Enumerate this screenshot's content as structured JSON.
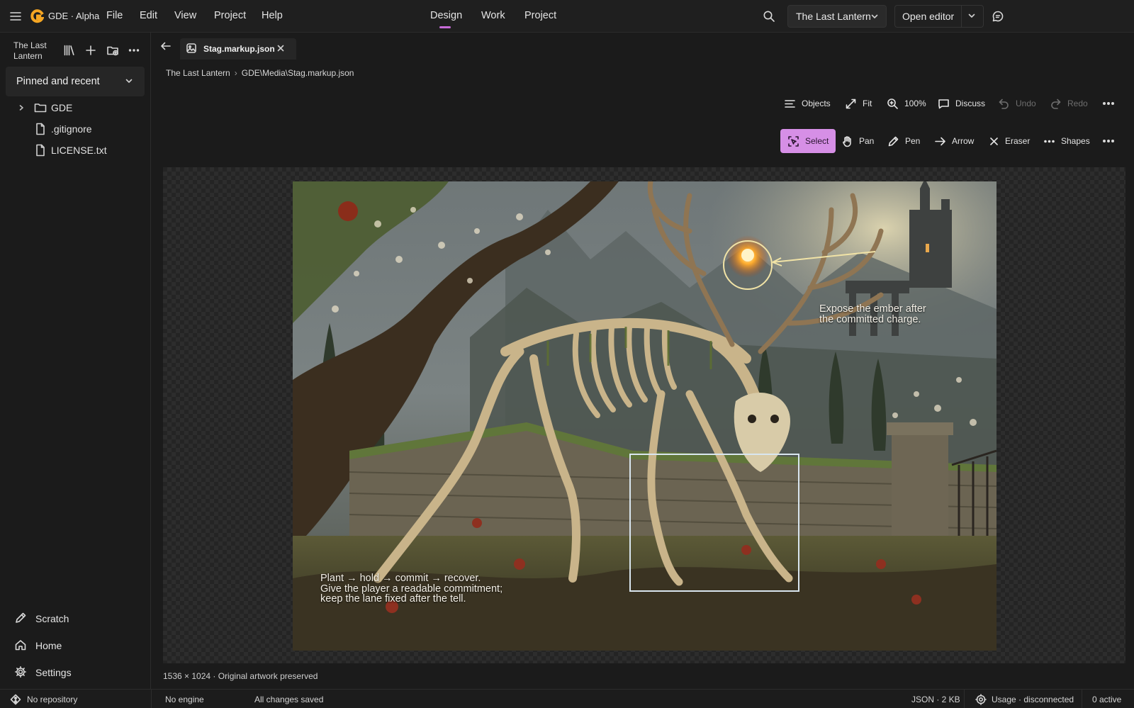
{
  "app": {
    "name": "GDE · Alpha",
    "logo_letter": "G",
    "logo_color": "#f5a623"
  },
  "menu": [
    "File",
    "Edit",
    "View",
    "Project",
    "Help"
  ],
  "center_tabs": {
    "design": "Design",
    "work": "Work",
    "project": "Project",
    "active": "Design",
    "accent": "#c86bd8"
  },
  "header": {
    "project_select": "The Last Lantern",
    "open_editor": "Open editor"
  },
  "sidebar": {
    "project_name": "The Last Lantern",
    "pinned_label": "Pinned and recent",
    "tree": [
      {
        "label": "GDE",
        "kind": "folder",
        "collapsed": true
      },
      {
        "label": ".gitignore",
        "kind": "file"
      },
      {
        "label": "LICENSE.txt",
        "kind": "file"
      }
    ],
    "nav": {
      "scratch": "Scratch",
      "home": "Home",
      "settings": "Settings"
    }
  },
  "editor": {
    "tab": {
      "label": "Stag.markup.json"
    },
    "breadcrumb": {
      "root": "The Last Lantern",
      "sep": "›",
      "path": "GDE\\Media\\Stag.markup.json"
    },
    "view_toolbar": {
      "objects": "Objects",
      "fit": "Fit",
      "zoom": "100%",
      "discuss": "Discuss",
      "undo": "Undo",
      "redo": "Redo",
      "undo_enabled": false,
      "redo_enabled": false
    },
    "tools": {
      "select": "Select",
      "pan": "Pan",
      "pen": "Pen",
      "arrow": "Arrow",
      "eraser": "Eraser",
      "shapes": "Shapes",
      "active": "Select",
      "active_color": "#d68fe6"
    },
    "annotations": {
      "ember_note_line1": "Expose the ember after",
      "ember_note_line2": "the committed charge.",
      "moveset_line1": "Plant → hold → commit → recover.",
      "moveset_line2": "Give the player a readable commitment;",
      "moveset_line3": "keep the lane fixed after the tell."
    },
    "canvas_meta": "1536 × 1024 · Original artwork preserved"
  },
  "statusbar": {
    "repository": "No repository",
    "engine": "No engine",
    "save_state": "All changes saved",
    "file_info": "JSON · 2 KB",
    "usage": "Usage · disconnected",
    "active_count": "0 active"
  }
}
